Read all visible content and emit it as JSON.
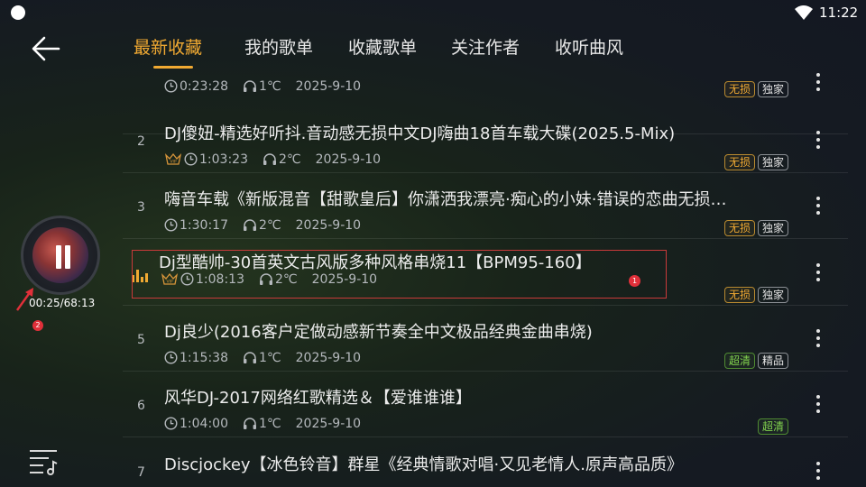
{
  "status": {
    "time": "11:22"
  },
  "tabs": [
    {
      "label": "最新收藏",
      "active": true
    },
    {
      "label": "我的歌单"
    },
    {
      "label": "收藏歌单"
    },
    {
      "label": "关注作者"
    },
    {
      "label": "收听曲风"
    }
  ],
  "player": {
    "progress": "00:25/68:13"
  },
  "annotations": {
    "badge1": "1",
    "badge2": "2"
  },
  "tracks": [
    {
      "num": "",
      "title": "",
      "duration": "0:23:28",
      "listeners": "1℃",
      "date": "2025-9-10",
      "vip": false,
      "tags": [
        "无损",
        "独家"
      ]
    },
    {
      "num": "2",
      "title": "DJ傻妞-精选好听抖.音动感无损中文DJ嗨曲18首车载大碟(2025.5-Mix)",
      "duration": "1:03:23",
      "listeners": "2℃",
      "date": "2025-9-10",
      "vip": true,
      "tags": [
        "无损",
        "独家"
      ]
    },
    {
      "num": "3",
      "title": "嗨音车载《新版混音【甜歌皇后】你潇洒我漂亮·痴心的小妹·错误的恋曲无损…",
      "duration": "1:30:17",
      "listeners": "2℃",
      "date": "2025-9-10",
      "vip": false,
      "tags": [
        "无损",
        "独家"
      ]
    },
    {
      "num": "",
      "title": "Dj型酷帅-30首英文古风版多种风格串烧11【BPM95-160】",
      "duration": "1:08:13",
      "listeners": "2℃",
      "date": "2025-9-10",
      "vip": true,
      "playing": true,
      "tags": [
        "无损",
        "独家"
      ]
    },
    {
      "num": "5",
      "title": "Dj良少(2016客户定做动感新节奏全中文极品经典金曲串烧)",
      "duration": "1:15:38",
      "listeners": "1℃",
      "date": "2025-9-10",
      "vip": false,
      "tags": [
        "超清",
        "精品"
      ]
    },
    {
      "num": "6",
      "title": "风华DJ-2017网络红歌精选＆【爱谁谁谁】",
      "duration": "1:04:00",
      "listeners": "1℃",
      "date": "2025-9-10",
      "vip": false,
      "tags": [
        "超清"
      ]
    },
    {
      "num": "7",
      "title": "Discjockey【冰色铃音】群星《经典情歌对唱·又见老情人.原声高品质》",
      "duration": "",
      "listeners": "",
      "date": "",
      "vip": false,
      "tags": []
    }
  ],
  "tag_colors": {
    "无损": "orange",
    "独家": "grey",
    "超清": "green",
    "精品": "grey"
  },
  "colors": {
    "accent": "#f0a932",
    "lossless": "#f0a932",
    "hd": "#82d34e",
    "annotation": "#e0303a"
  }
}
